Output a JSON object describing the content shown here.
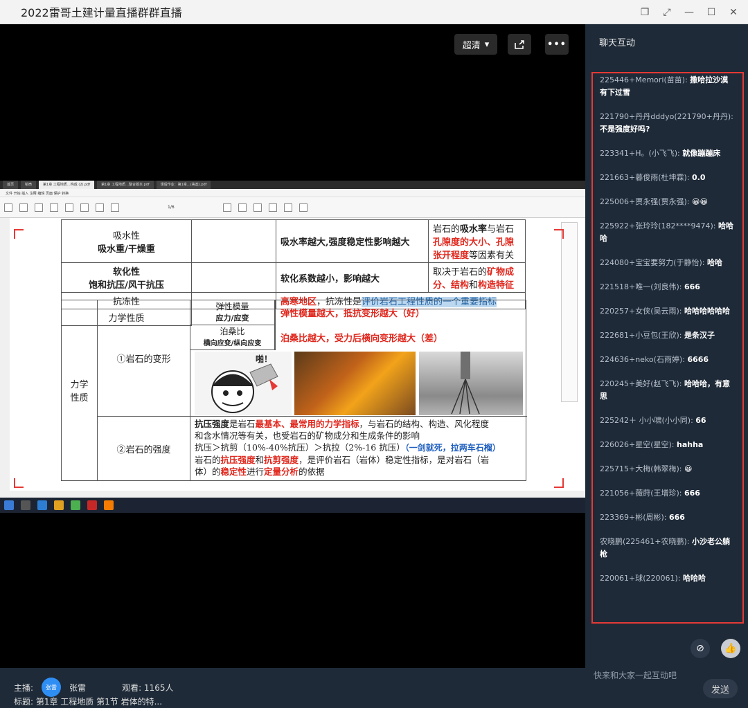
{
  "window": {
    "title": "2022雷哥土建计量直播群群直播"
  },
  "video": {
    "quality_label": "超清"
  },
  "screen": {
    "tabs": [
      "首页",
      "稻壳",
      "第1章 工程地质…构成 (2).pdf",
      "第1章 工程地质…整合版本.pdf",
      "课后作业：第1章…(答案).pdf"
    ],
    "menu": "文件 开始 插入 注释 编辑 页面 保护 转换",
    "page_indicator": "1/6",
    "table": {
      "r1c1a": "吸水性",
      "r1c1b": "吸水重/干燥重",
      "r1c3": "吸水率越大,强度稳定性影响越大",
      "r1c4_pre": "岩石的",
      "r1c4_bold": "吸水率",
      "r1c4_mid": "与岩石",
      "r1c4_red": "孔隙度的大小、孔隙张开程度",
      "r1c4_post": "等因素有关",
      "r2c1a": "软化性",
      "r2c1b": "饱和抗压/风干抗压",
      "r2c3": "软化系数越小，影响越大",
      "r2c4_pre": "取决于岩石的",
      "r2c4_red": "矿物成分、结构",
      "r2c4_mid": "和",
      "r2c4_red2": "构造特征",
      "r3c1": "抗冻性",
      "r3c3_red": "高寒地区",
      "r3c3_mid": "，抗冻性是",
      "r3c3_hl": "评价岩石工程性质的一个重要指标",
      "group_label": "力学性质",
      "sub1": "①岩石的变形",
      "sub1_a": "弹性模量",
      "sub1_a2": "应力/应变",
      "sub1_a3": "弹性模量越大，抵抗变形越大（好）",
      "sub1_b": "泊桑比",
      "sub1_b2": "横向应变/纵向应变",
      "sub1_b3": "泊桑比越大，受力后横向变形越大（差）",
      "meme_text": "啪！",
      "sub2": "②岩石的强度",
      "s2_l1_bold": "抗压强度",
      "s2_l1_a": "是岩石",
      "s2_l1_red": "最基本、最常用的力学指标",
      "s2_l1_b": "，与岩石的结构、构造、风化程度",
      "s2_l2": "和含水情况等有关，也受岩石的矿物成分和生成条件的影响",
      "s2_l3": "抗压＞抗剪（10%-40%抗压）＞抗拉（2%-16 抗压）",
      "s2_l3_blue": "（一剑就死，拉两车石榴）",
      "s2_l4_a": "岩石的",
      "s2_l4_red1": "抗压强度",
      "s2_l4_b": "和",
      "s2_l4_red2": "抗剪强度",
      "s2_l4_c": "，是评价岩石（岩体）稳定性指标，是对岩石（岩",
      "s2_l5_a": "体）的",
      "s2_l5_red1": "稳定性",
      "s2_l5_b": "进行",
      "s2_l5_red2": "定量分析",
      "s2_l5_c": "的依据"
    }
  },
  "host": {
    "label": "主播:",
    "avatar_text": "张雷",
    "name": "张雷",
    "viewers": "观看: 1165人",
    "subject": "标题: 第1章 工程地质 第1节 岩体的特..."
  },
  "chat": {
    "title": "聊天互动",
    "messages": [
      {
        "user": "225446+Memori(苗苗):",
        "text": "撒哈拉沙漠有下过雪"
      },
      {
        "user": "221790+丹丹dddyo(221790+丹丹):",
        "text": "不是强度好吗?"
      },
      {
        "user": "223341+H。(小飞飞):",
        "text": "就像蹦蹦床"
      },
      {
        "user": "221663+暮俊雨(杜坤霖):",
        "text": "0.0"
      },
      {
        "user": "225006+贾永强(贾永强):",
        "text": "😀😀"
      },
      {
        "user": "225922+张玲玲(182****9474):",
        "text": "哈哈哈"
      },
      {
        "user": "224080+宝宝要努力(于静怡):",
        "text": "哈哈"
      },
      {
        "user": "221518+唯一(刘良伟):",
        "text": "666"
      },
      {
        "user": "220257+女侠(吴云雨):",
        "text": "哈哈哈哈哈哈"
      },
      {
        "user": "222681+小豆包(王欣):",
        "text": "是条汉子"
      },
      {
        "user": "224636+neko(石雨婷):",
        "text": "6666"
      },
      {
        "user": "220245+美好(赵飞飞):",
        "text": "哈哈哈，有意思"
      },
      {
        "user": "225242＋ 小小啸(小小同):",
        "text": "66"
      },
      {
        "user": "226026+星空(星空):",
        "text": "hahha"
      },
      {
        "user": "225715+大梅(韩翠梅):",
        "text": "😀"
      },
      {
        "user": "221056+薇莳(王增珍):",
        "text": "666"
      },
      {
        "user": "223369+彬(周彬):",
        "text": "666"
      },
      {
        "user": "农晓鹏(225461+农晓鹏):",
        "text": "小沙老公躺枪"
      },
      {
        "user": "220061+球(220061):",
        "text": "哈哈哈"
      }
    ],
    "input_placeholder": "快来和大家一起互动吧",
    "send_label": "发送"
  }
}
